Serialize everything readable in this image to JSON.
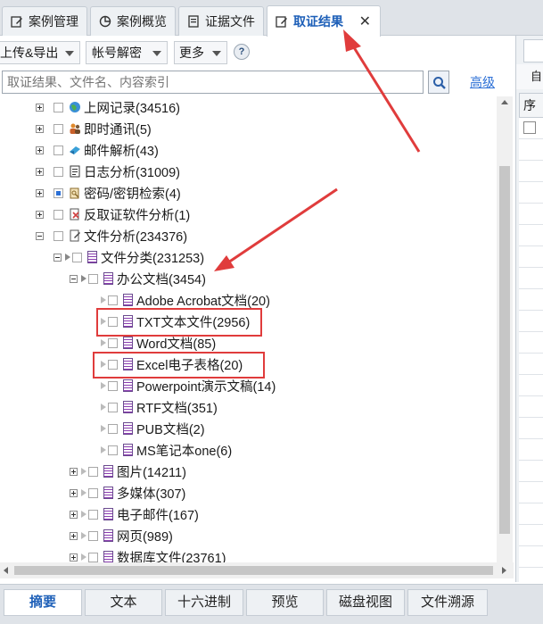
{
  "tabs": [
    {
      "label": "案例管理",
      "icon": "case-manage-icon"
    },
    {
      "label": "案例概览",
      "icon": "overview-icon"
    },
    {
      "label": "证据文件",
      "icon": "evidence-file-icon"
    },
    {
      "label": "取证结果",
      "icon": "forensic-result-icon",
      "active": true
    }
  ],
  "toolbar": {
    "upload_export": "上传&导出",
    "account_decrypt": "帐号解密",
    "more": "更多",
    "help": "?"
  },
  "search": {
    "placeholder": "取证结果、文件名、内容索引",
    "advanced": "高级"
  },
  "tree": {
    "items": [
      {
        "label": "上网记录(34516)",
        "icon": "globe-icon"
      },
      {
        "label": "即时通讯(5)",
        "icon": "im-users-icon"
      },
      {
        "label": "邮件解析(43)",
        "icon": "mail-icon"
      },
      {
        "label": "日志分析(31009)",
        "icon": "log-icon"
      },
      {
        "label": "密码/密钥检索(4)",
        "icon": "key-search-icon"
      },
      {
        "label": "反取证软件分析(1)",
        "icon": "anti-forensic-icon"
      },
      {
        "label": "文件分析(234376)",
        "icon": "file-analysis-icon"
      },
      {
        "label": "文件分类(231253)",
        "icon": "document-icon"
      },
      {
        "label": "办公文档(3454)",
        "icon": "document-icon"
      },
      {
        "label": "Adobe Acrobat文档(20)",
        "icon": "document-icon"
      },
      {
        "label": "TXT文本文件(2956)",
        "icon": "document-icon"
      },
      {
        "label": "Word文档(85)",
        "icon": "document-icon"
      },
      {
        "label": "Excel电子表格(20)",
        "icon": "document-icon"
      },
      {
        "label": "Powerpoint演示文稿(14)",
        "icon": "document-icon"
      },
      {
        "label": "RTF文档(351)",
        "icon": "document-icon"
      },
      {
        "label": "PUB文档(2)",
        "icon": "document-icon"
      },
      {
        "label": "MS笔记本one(6)",
        "icon": "document-icon"
      },
      {
        "label": "图片(14211)",
        "icon": "document-icon"
      },
      {
        "label": "多媒体(307)",
        "icon": "document-icon"
      },
      {
        "label": "电子邮件(167)",
        "icon": "document-icon"
      },
      {
        "label": "网页(989)",
        "icon": "document-icon"
      },
      {
        "label": "数据库文件(23761)",
        "icon": "document-icon"
      }
    ]
  },
  "right_panel": {
    "bar_text": "自",
    "column_header": "序号"
  },
  "bottom_tabs": [
    {
      "label": "摘要",
      "active": true
    },
    {
      "label": "文本"
    },
    {
      "label": "十六进制"
    },
    {
      "label": "预览"
    },
    {
      "label": "磁盘视图"
    },
    {
      "label": "文件溯源"
    }
  ],
  "colors": {
    "accent": "#1d5fb8",
    "annotation": "#e03c3c",
    "link": "#2b6fd6"
  }
}
